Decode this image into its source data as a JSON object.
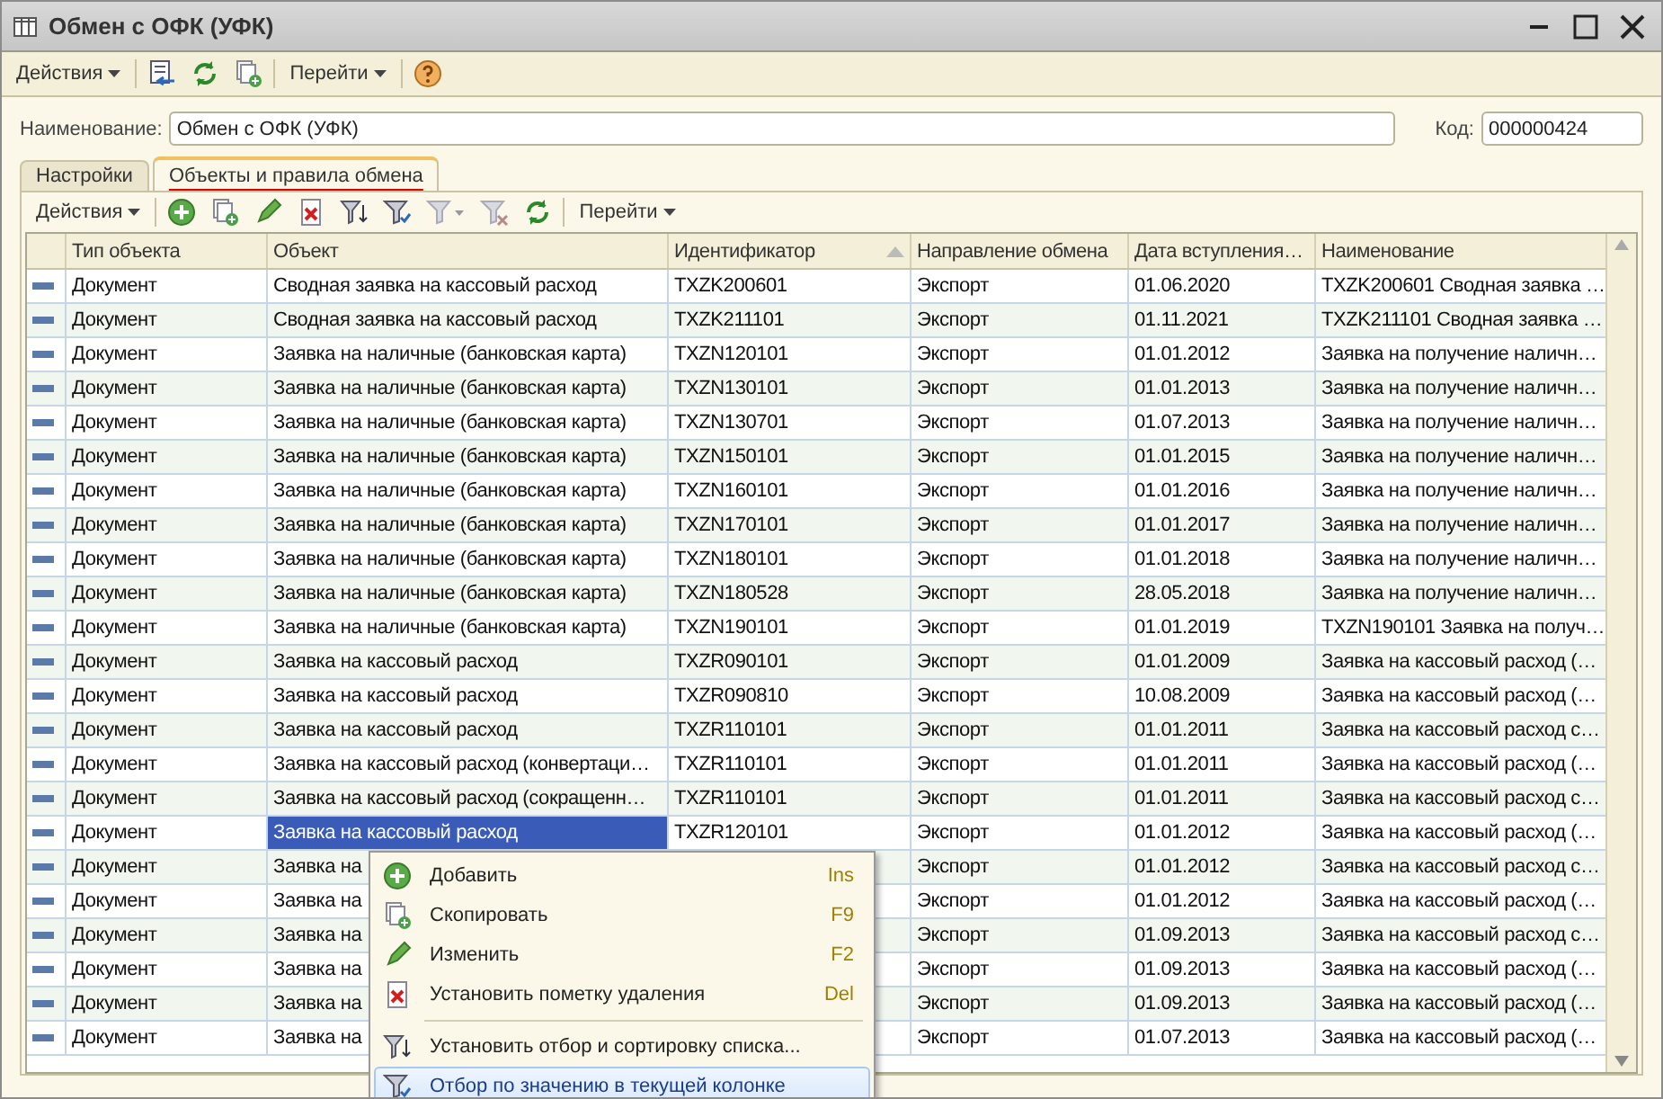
{
  "window": {
    "title": "Обмен с ОФК (УФК)"
  },
  "toolbar": {
    "items": [
      {
        "kind": "menu",
        "label": "Действия"
      },
      {
        "kind": "save"
      },
      {
        "kind": "refresh"
      },
      {
        "kind": "copy"
      },
      {
        "kind": "menu",
        "label": "Перейти"
      },
      {
        "kind": "help"
      }
    ]
  },
  "name_field": {
    "label": "Наименование:",
    "value": "Обмен с ОФК (УФК)"
  },
  "code_field": {
    "label": "Код:",
    "value": "000000424"
  },
  "tabs": [
    {
      "label": "Настройки",
      "selected": false
    },
    {
      "label": "Объекты и правила обмена",
      "selected": true
    }
  ],
  "table_toolbar": {
    "items": [
      {
        "kind": "menu",
        "label": "Действия"
      },
      {
        "kind": "add"
      },
      {
        "kind": "copy"
      },
      {
        "kind": "edit"
      },
      {
        "kind": "delete"
      },
      {
        "kind": "filterset"
      },
      {
        "kind": "filter"
      },
      {
        "kind": "filtermenu"
      },
      {
        "kind": "filteroff"
      },
      {
        "kind": "refresh"
      },
      {
        "kind": "menu",
        "label": "Перейти"
      }
    ]
  },
  "table": {
    "columns": [
      {
        "label": "Тип объекта",
        "sorted": false
      },
      {
        "label": "Объект",
        "sorted": false
      },
      {
        "label": "Идентификатор",
        "sorted": true
      },
      {
        "label": "Направление обмена",
        "sorted": false
      },
      {
        "label": "Дата вступления…",
        "sorted": false
      },
      {
        "label": "Наименование",
        "sorted": false
      }
    ],
    "rows": [
      {
        "type": "Документ",
        "object": "Сводная заявка на кассовый расход",
        "id": "TXZK200601",
        "direction": "Экспорт",
        "date": "01.06.2020",
        "name": "TXZK200601 Сводная заявка …",
        "selected": false
      },
      {
        "type": "Документ",
        "object": "Сводная заявка на кассовый расход",
        "id": "TXZK211101",
        "direction": "Экспорт",
        "date": "01.11.2021",
        "name": "TXZK211101 Сводная заявка …",
        "selected": false
      },
      {
        "type": "Документ",
        "object": "Заявка на наличные (банковская карта)",
        "id": "TXZN120101",
        "direction": "Экспорт",
        "date": "01.01.2012",
        "name": "Заявка на получение наличн…",
        "selected": false
      },
      {
        "type": "Документ",
        "object": "Заявка на наличные (банковская карта)",
        "id": "TXZN130101",
        "direction": "Экспорт",
        "date": "01.01.2013",
        "name": "Заявка на получение наличн…",
        "selected": false
      },
      {
        "type": "Документ",
        "object": "Заявка на наличные (банковская карта)",
        "id": "TXZN130701",
        "direction": "Экспорт",
        "date": "01.07.2013",
        "name": "Заявка на получение наличн…",
        "selected": false
      },
      {
        "type": "Документ",
        "object": "Заявка на наличные (банковская карта)",
        "id": "TXZN150101",
        "direction": "Экспорт",
        "date": "01.01.2015",
        "name": "Заявка на получение наличн…",
        "selected": false
      },
      {
        "type": "Документ",
        "object": "Заявка на наличные (банковская карта)",
        "id": "TXZN160101",
        "direction": "Экспорт",
        "date": "01.01.2016",
        "name": "Заявка на получение наличн…",
        "selected": false
      },
      {
        "type": "Документ",
        "object": "Заявка на наличные (банковская карта)",
        "id": "TXZN170101",
        "direction": "Экспорт",
        "date": "01.01.2017",
        "name": "Заявка на получение наличн…",
        "selected": false
      },
      {
        "type": "Документ",
        "object": "Заявка на наличные (банковская карта)",
        "id": "TXZN180101",
        "direction": "Экспорт",
        "date": "01.01.2018",
        "name": "Заявка на получение наличн…",
        "selected": false
      },
      {
        "type": "Документ",
        "object": "Заявка на наличные (банковская карта)",
        "id": "TXZN180528",
        "direction": "Экспорт",
        "date": "28.05.2018",
        "name": "Заявка на получение наличн…",
        "selected": false
      },
      {
        "type": "Документ",
        "object": "Заявка на наличные (банковская карта)",
        "id": "TXZN190101",
        "direction": "Экспорт",
        "date": "01.01.2019",
        "name": "TXZN190101 Заявка на получ…",
        "selected": false
      },
      {
        "type": "Документ",
        "object": "Заявка на кассовый расход",
        "id": "TXZR090101",
        "direction": "Экспорт",
        "date": "01.01.2009",
        "name": "Заявка на кассовый расход (…",
        "selected": false
      },
      {
        "type": "Документ",
        "object": "Заявка на кассовый расход",
        "id": "TXZR090810",
        "direction": "Экспорт",
        "date": "10.08.2009",
        "name": "Заявка на кассовый расход (…",
        "selected": false
      },
      {
        "type": "Документ",
        "object": "Заявка на кассовый расход",
        "id": "TXZR110101",
        "direction": "Экспорт",
        "date": "01.01.2011",
        "name": "Заявка на кассовый расход с…",
        "selected": false
      },
      {
        "type": "Документ",
        "object": "Заявка на кассовый расход (конвертаци…",
        "id": "TXZR110101",
        "direction": "Экспорт",
        "date": "01.01.2011",
        "name": "Заявка на кассовый расход (…",
        "selected": false
      },
      {
        "type": "Документ",
        "object": "Заявка на кассовый расход (сокращенн…",
        "id": "TXZR110101",
        "direction": "Экспорт",
        "date": "01.01.2011",
        "name": "Заявка на кассовый расход с…",
        "selected": false
      },
      {
        "type": "Документ",
        "object": "Заявка на кассовый расход",
        "id": "TXZR120101",
        "direction": "Экспорт",
        "date": "01.01.2012",
        "name": "Заявка на кассовый расход (…",
        "selected": true
      },
      {
        "type": "Документ",
        "object": "Заявка на",
        "direction": "Экспорт",
        "date": "01.01.2012",
        "name": "Заявка на кассовый расход с…",
        "selected": false
      },
      {
        "type": "Документ",
        "object": "Заявка на",
        "direction": "Экспорт",
        "date": "01.01.2012",
        "name": "Заявка на кассовый расход (…",
        "selected": false
      },
      {
        "type": "Документ",
        "object": "Заявка на",
        "direction": "Экспорт",
        "date": "01.09.2013",
        "name": "Заявка на кассовый расход с…",
        "selected": false
      },
      {
        "type": "Документ",
        "object": "Заявка на",
        "direction": "Экспорт",
        "date": "01.09.2013",
        "name": "Заявка на кассовый расход (…",
        "selected": false
      },
      {
        "type": "Документ",
        "object": "Заявка на",
        "direction": "Экспорт",
        "date": "01.09.2013",
        "name": "Заявка на кассовый расход (…",
        "selected": false
      },
      {
        "type": "Документ",
        "object": "Заявка на",
        "direction": "Экспорт",
        "date": "01.07.2013",
        "name": "Заявка на кассовый расход (…",
        "selected": false
      }
    ]
  },
  "context_menu": {
    "items": [
      {
        "kind": "add",
        "label": "Добавить",
        "shortcut": "Ins",
        "selected": false
      },
      {
        "kind": "copy",
        "label": "Скопировать",
        "shortcut": "F9",
        "selected": false
      },
      {
        "kind": "edit",
        "label": "Изменить",
        "shortcut": "F2",
        "selected": false
      },
      {
        "kind": "delete",
        "label": "Установить пометку удаления",
        "shortcut": "Del",
        "selected": false
      },
      {
        "kind": "separator"
      },
      {
        "kind": "filterset",
        "label": "Установить отбор и сортировку списка...",
        "selected": false
      },
      {
        "kind": "filter",
        "label": "Отбор по значению в текущей колонке",
        "selected": true
      }
    ]
  }
}
